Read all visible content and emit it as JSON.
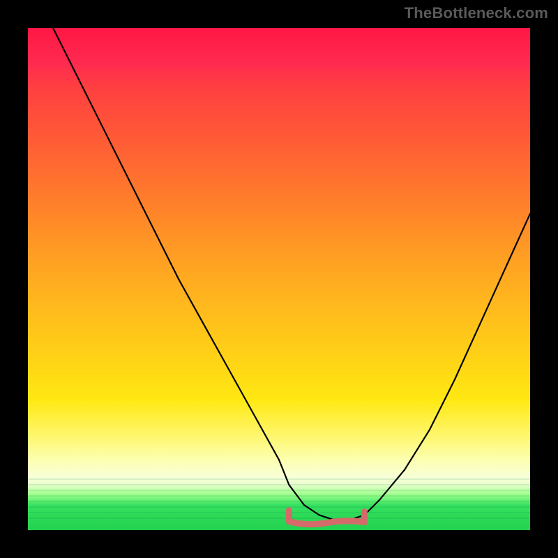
{
  "watermark": "TheBottleneck.com",
  "chart_data": {
    "type": "line",
    "title": "",
    "xlabel": "",
    "ylabel": "",
    "xlim": [
      0,
      100
    ],
    "ylim": [
      0,
      100
    ],
    "background_gradient": {
      "description": "Vertical gradient mapping bottleneck severity",
      "stops": [
        {
          "pct": 0,
          "color": "#ff1744"
        },
        {
          "pct": 22,
          "color": "#ff5a36"
        },
        {
          "pct": 44,
          "color": "#ff9a24"
        },
        {
          "pct": 66,
          "color": "#ffd316"
        },
        {
          "pct": 86,
          "color": "#fcffb0"
        },
        {
          "pct": 95,
          "color": "#36e060"
        },
        {
          "pct": 100,
          "color": "#22d24e"
        }
      ]
    },
    "series": [
      {
        "name": "bottleneck-curve",
        "x": [
          5,
          10,
          15,
          20,
          25,
          30,
          35,
          40,
          45,
          50,
          52,
          55,
          58,
          61,
          64,
          67,
          70,
          75,
          80,
          85,
          90,
          95,
          100
        ],
        "values": [
          100,
          90,
          80,
          70,
          60,
          50,
          41,
          32,
          23,
          14,
          9,
          5,
          3,
          2,
          2,
          3,
          6,
          12,
          20,
          30,
          41,
          52,
          63
        ]
      }
    ],
    "accent": {
      "name": "optimal-range-marker",
      "color": "#d46a6a",
      "x_range": [
        52,
        67
      ],
      "y": 2
    }
  }
}
